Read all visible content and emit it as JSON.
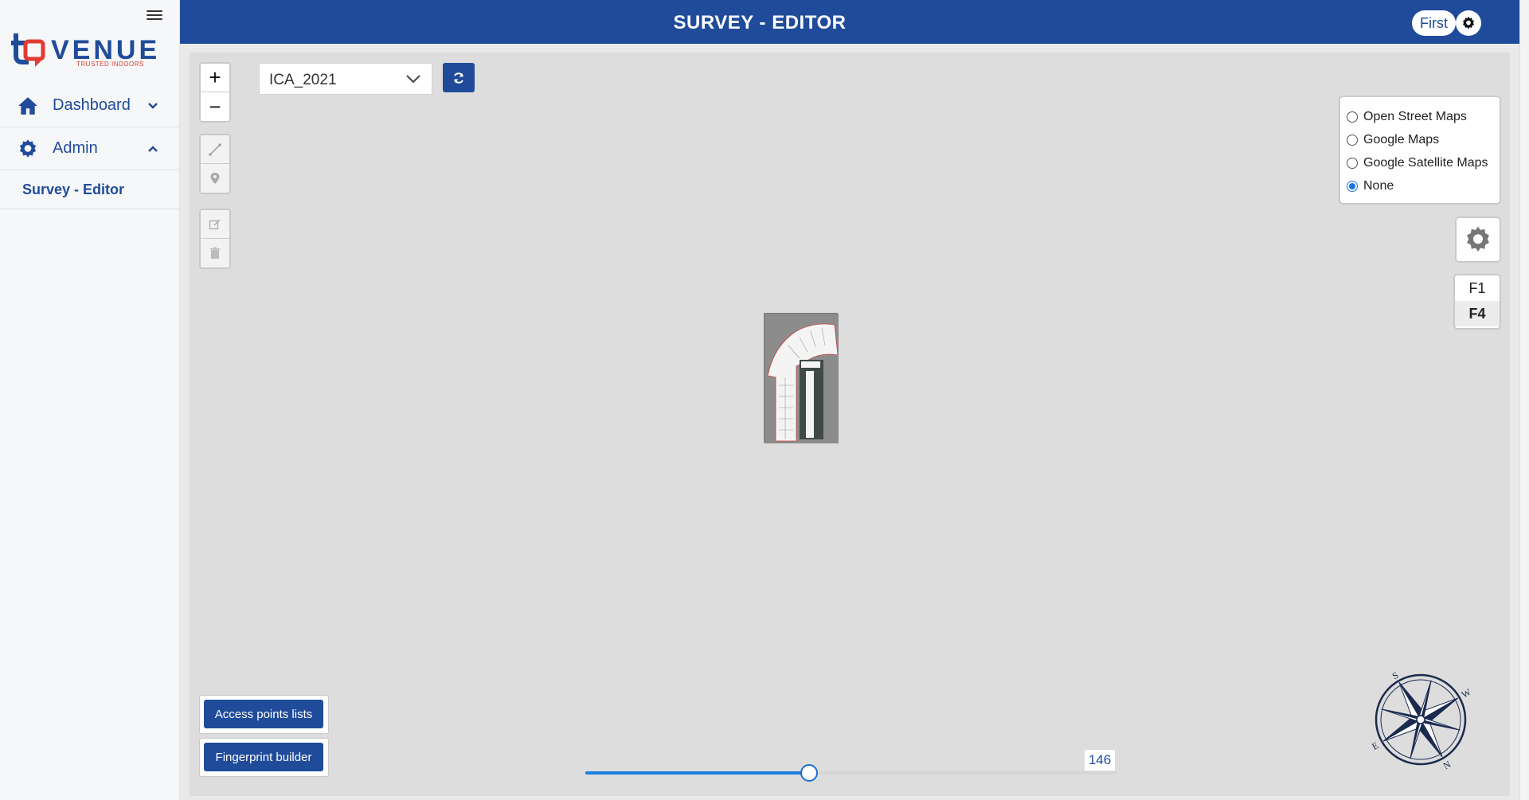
{
  "app": {
    "logo_text": "VENUE",
    "logo_tagline": "TRUSTED INDOORS",
    "header_title": "SURVEY - EDITOR",
    "user_label": "First"
  },
  "sidebar": {
    "items": [
      {
        "label": "Dashboard",
        "icon": "home-icon",
        "expanded": false
      },
      {
        "label": "Admin",
        "icon": "gear-icon",
        "expanded": true
      }
    ],
    "subitems": [
      {
        "label": "Survey - Editor",
        "active": true
      }
    ]
  },
  "map": {
    "zoom_in_label": "+",
    "zoom_out_label": "−",
    "venue_select": {
      "value": "ICA_2021"
    },
    "base_layers": {
      "options": [
        {
          "label": "Open Street Maps",
          "checked": false
        },
        {
          "label": "Google Maps",
          "checked": false
        },
        {
          "label": "Google Satellite Maps",
          "checked": false
        },
        {
          "label": "None",
          "checked": true
        }
      ]
    },
    "floors": [
      {
        "label": "F1",
        "active": false
      },
      {
        "label": "F4",
        "active": true
      }
    ],
    "actions": {
      "access_points": "Access points lists",
      "fingerprint": "Fingerprint builder"
    },
    "slider": {
      "value": 146,
      "fraction": 0.42
    },
    "compass_letters": {
      "s": "S",
      "w": "W",
      "e": "E",
      "n": "N"
    }
  },
  "colors": {
    "brand": "#1f4b9a",
    "accent": "#1a7fe0",
    "logo_red": "#e23b33"
  }
}
